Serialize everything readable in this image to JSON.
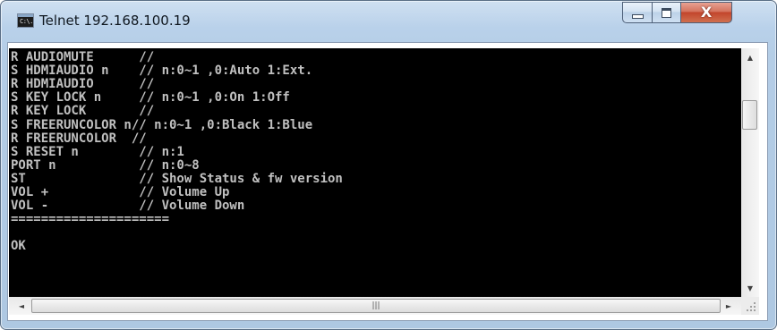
{
  "window": {
    "title": "Telnet 192.168.100.19",
    "icon": "console-icon",
    "icon_text": "C:\\."
  },
  "controls": {
    "minimize_icon": "minimize-icon",
    "maximize_icon": "maximize-icon",
    "close_icon": "close-icon",
    "close_glyph": "X"
  },
  "console": {
    "background": "#000000",
    "foreground": "#c0c0c0",
    "lines": [
      "R AUDIOMUTE      //",
      "S HDMIAUDIO n    // n:0~1 ,0:Auto 1:Ext.",
      "R HDMIAUDIO      //",
      "S KEY LOCK n     // n:0~1 ,0:On 1:Off",
      "R KEY LOCK       //",
      "S FREERUNCOLOR n// n:0~1 ,0:Black 1:Blue",
      "R FREERUNCOLOR  //",
      "S RESET n        // n:1",
      "PORT n           // n:0~8",
      "ST               // Show Status & fw version",
      "VOL +            // Volume Up",
      "VOL -            // Volume Down",
      "=====================",
      "",
      "OK"
    ]
  },
  "scrollbars": {
    "up_arrow": "▲",
    "down_arrow": "▼",
    "left_arrow": "◄",
    "right_arrow": "►",
    "grip": "|||"
  }
}
